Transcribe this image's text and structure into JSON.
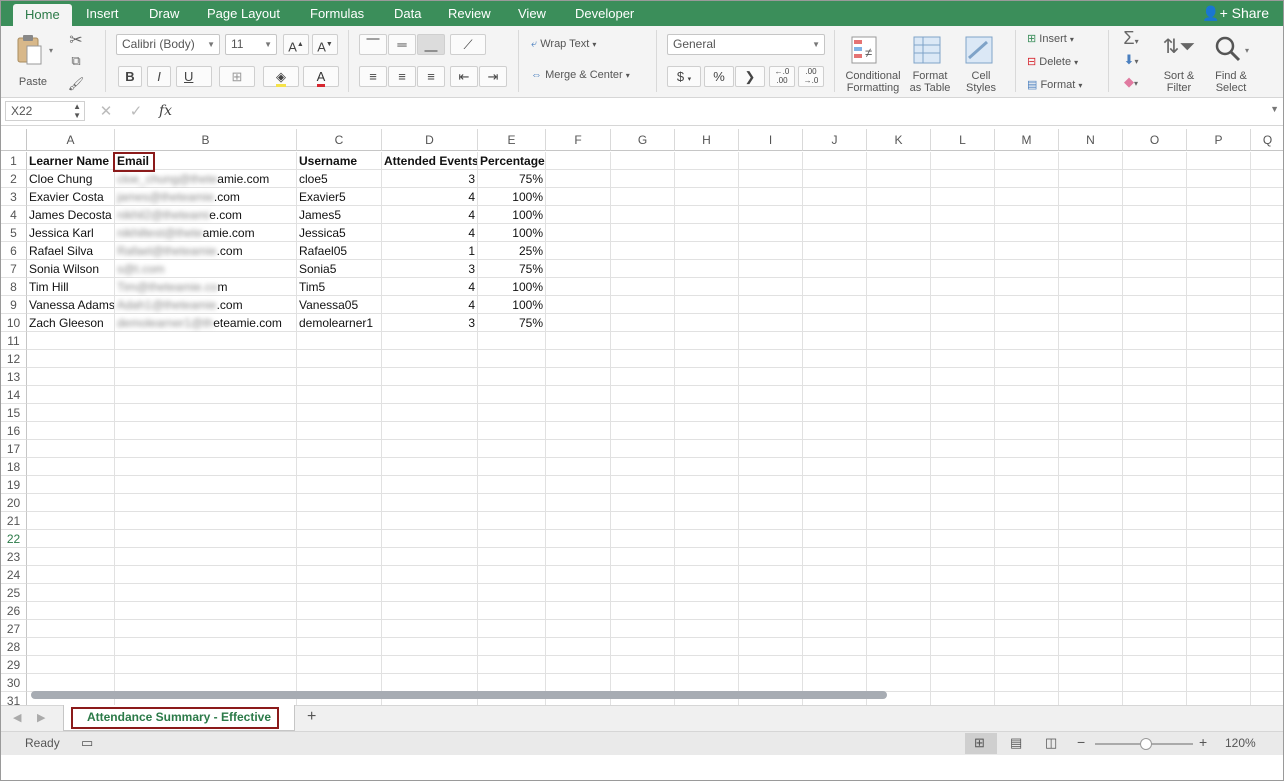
{
  "tabs": [
    "Home",
    "Insert",
    "Draw",
    "Page Layout",
    "Formulas",
    "Data",
    "Review",
    "View",
    "Developer"
  ],
  "share_label": "Share",
  "ribbon": {
    "paste": "Paste",
    "font_name": "Calibri (Body)",
    "font_size": "11",
    "bold": "B",
    "italic": "I",
    "underline": "U",
    "wrap_text": "Wrap Text",
    "merge_center": "Merge & Center",
    "number_format": "General",
    "currency": "$",
    "percent": "%",
    "comma": "❯",
    "conditional_formatting_1": "Conditional",
    "conditional_formatting_2": "Formatting",
    "format_table_1": "Format",
    "format_table_2": "as Table",
    "cell_styles_1": "Cell",
    "cell_styles_2": "Styles",
    "insert": "Insert",
    "delete": "Delete",
    "format": "Format",
    "sort_filter_1": "Sort &",
    "sort_filter_2": "Filter",
    "find_select_1": "Find &",
    "find_select_2": "Select"
  },
  "formula_bar": {
    "name_box": "X22",
    "fx": "fx",
    "value": ""
  },
  "columns": [
    "A",
    "B",
    "C",
    "D",
    "E",
    "F",
    "G",
    "H",
    "I",
    "J",
    "K",
    "L",
    "M",
    "N",
    "O",
    "P",
    "Q"
  ],
  "rows": [
    "1",
    "2",
    "3",
    "4",
    "5",
    "6",
    "7",
    "8",
    "9",
    "10",
    "11",
    "12",
    "13",
    "14",
    "15",
    "16",
    "17",
    "18",
    "19",
    "20",
    "21",
    "22",
    "23",
    "24",
    "25",
    "26",
    "27",
    "28",
    "29",
    "30",
    "31"
  ],
  "selected_row": "22",
  "table": {
    "headers": [
      "Learner Name",
      "Email",
      "Username",
      "Attended Events",
      "Percentage"
    ],
    "rows": [
      {
        "name": "Cloe Chung",
        "email_blur": "cloe_chung@thete",
        "email_vis": "amie.com",
        "username": "cloe5",
        "events": "3",
        "pct": "75%"
      },
      {
        "name": "Exavier Costa",
        "email_blur": "james@theteamie",
        "email_vis": ".com",
        "username": "Exavier5",
        "events": "4",
        "pct": "100%"
      },
      {
        "name": "James Decosta",
        "email_blur": "nikhil2@theteami",
        "email_vis": "e.com",
        "username": "James5",
        "events": "4",
        "pct": "100%"
      },
      {
        "name": "Jessica Karl",
        "email_blur": "nikhiltest@thete",
        "email_vis": "amie.com",
        "username": "Jessica5",
        "events": "4",
        "pct": "100%"
      },
      {
        "name": "Rafael Silva",
        "email_blur": "Rafael@theteamie",
        "email_vis": ".com",
        "username": "Rafael05",
        "events": "1",
        "pct": "25%"
      },
      {
        "name": "Sonia Wilson",
        "email_blur": "s@t.com",
        "email_vis": "",
        "username": "Sonia5",
        "events": "3",
        "pct": "75%"
      },
      {
        "name": "Tim Hill",
        "email_blur": "Tim@theteamie.co",
        "email_vis": "m",
        "username": "Tim5",
        "events": "4",
        "pct": "100%"
      },
      {
        "name": "Vanessa Adams",
        "email_blur": "Adah1@theteamie",
        "email_vis": ".com",
        "username": "Vanessa05",
        "events": "4",
        "pct": "100%"
      },
      {
        "name": "Zach Gleeson",
        "email_blur": "demolearner1@th",
        "email_vis": "eteamie.com",
        "username": "demolearner1",
        "events": "3",
        "pct": "75%"
      }
    ]
  },
  "sheet_tab": "Attendance Summary - Effective",
  "add_sheet": "+",
  "status": "Ready",
  "zoom": "120%",
  "zoom_minus": "−",
  "zoom_plus": "+",
  "colors": {
    "accent": "#3b8e5a",
    "highlight_box": "#8b1a1a"
  }
}
